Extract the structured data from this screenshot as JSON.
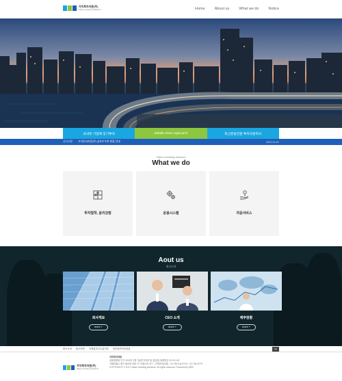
{
  "header": {
    "logo_ko": "가치투자자문(주)",
    "logo_en": "Value Investing Advisors",
    "nav": [
      "Home",
      "About us",
      "What we do",
      "Notice"
    ]
  },
  "tabs": [
    "국내유 기업에 장기투자",
    "Middle down Approach",
    "최신운용전문 투자자문회사"
  ],
  "notice": {
    "label": "공지사항",
    "text": "가치투자자문(주) 상호수수료 변경 안내",
    "date": "2020.04.21"
  },
  "what_we_do": {
    "subtitle": "Value Investing Advisors",
    "title": "What we do",
    "cards": [
      {
        "label": "투자철학, 윤리강령",
        "icon": "puzzle-icon"
      },
      {
        "label": "운용시스템",
        "icon": "gears-icon"
      },
      {
        "label": "자문서비스",
        "icon": "hand-coin-icon"
      }
    ]
  },
  "about": {
    "title": "Aout us",
    "subtitle": "회사소개",
    "cards": [
      {
        "label": "회사개요",
        "button": "more +"
      },
      {
        "label": "CEO 소개",
        "button": "more +"
      },
      {
        "label": "재무현황",
        "button": "more +"
      }
    ]
  },
  "footer": {
    "links": [
      "회사소개",
      "회사연혁",
      "이메일무단수집거부",
      "개인정보처리방침"
    ],
    "top_button": "top",
    "company": "가치투자자문",
    "info": [
      "금융위원회 인가 2002년 3월 7일(투자자문 및 일임업) 등록번호 03-03-120",
      "서울특별시 중구 을지로 관련 7F, 대표이사 조**, 고객센터(대표) : 02-780-5113 FAX : 02-780-5779",
      "COPYRIGHT © 2017 Value Investing Advisors. All rights reserved. Powered by MRV"
    ]
  },
  "colors": {
    "tab_blue": "#1aa6e0",
    "tab_green": "#8dc63f",
    "notice_bar": "#1e5fb8",
    "about_bg": "#10262c"
  }
}
